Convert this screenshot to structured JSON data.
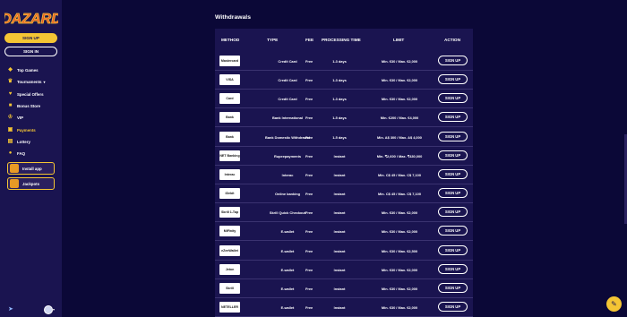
{
  "brand": {
    "name": "DAZARD",
    "accent": "#f4c534",
    "bg": "#0b0837",
    "panel": "#1a1450"
  },
  "auth": {
    "signup_label": "SIGN UP",
    "signin_label": "SIGN IN"
  },
  "nav": [
    {
      "label": "Top Games",
      "icon": "game-controller-icon"
    },
    {
      "label": "Tournaments",
      "icon": "trophy-icon",
      "has_caret": true
    },
    {
      "label": "Special Offers",
      "icon": "gift-icon"
    },
    {
      "label": "Bonus Store",
      "icon": "store-icon"
    },
    {
      "label": "VIP",
      "icon": "crown-icon"
    },
    {
      "label": "Payments",
      "icon": "wallet-icon",
      "active": true
    },
    {
      "label": "Lottery",
      "icon": "ticket-icon"
    },
    {
      "label": "FAQ",
      "icon": "chat-icon"
    }
  ],
  "promos": [
    {
      "label": "Install app",
      "icon": "download-icon"
    },
    {
      "label": "Jackpots",
      "icon": "jackpot-icon"
    }
  ],
  "page": {
    "title": "Withdrawals"
  },
  "table": {
    "headers": {
      "method": "METHOD",
      "type": "TYPE",
      "fee": "FEE",
      "processing": "PROCESSING TIME",
      "limit": "LIMIT",
      "action": "ACTION"
    },
    "rows": [
      {
        "logo": "Mastercard",
        "type": "Credit Card",
        "fee": "Free",
        "time": "1-3 days",
        "limit": "Min. €30 / Max. €2,000",
        "action": "SIGN UP"
      },
      {
        "logo": "VISA",
        "type": "Credit Card",
        "fee": "Free",
        "time": "1-3 days",
        "limit": "Min. €30 / Max. €2,000",
        "action": "SIGN UP"
      },
      {
        "logo": "Card",
        "type": "Credit Card",
        "fee": "Free",
        "time": "1-3 days",
        "limit": "Min. €30 / Max. €2,000",
        "action": "SIGN UP"
      },
      {
        "logo": "Bank",
        "type": "Bank International",
        "fee": "Free",
        "time": "1-5 days",
        "limit": "Min. €200 / Max. €4,000",
        "action": "SIGN UP"
      },
      {
        "logo": "Bank",
        "type": "Bank Domestic Withdrawal",
        "fee": "Free",
        "time": "1-5 days",
        "limit": "Min. A$ 300 / Max. A$ 4,000",
        "action": "SIGN UP"
      },
      {
        "logo": "NET Banking",
        "type": "Rupeepayments",
        "fee": "Free",
        "time": "Instant",
        "limit": "Min. ₹2,600 / Max. ₹430,000",
        "action": "SIGN UP"
      },
      {
        "logo": "Interac",
        "type": "Interac",
        "fee": "Free",
        "time": "Instant",
        "limit": "Min. C$ 45 / Max. C$ 7,100",
        "action": "SIGN UP"
      },
      {
        "logo": "iDebit",
        "type": "Online banking",
        "fee": "Free",
        "time": "Instant",
        "limit": "Min. C$ 45 / Max. C$ 7,100",
        "action": "SIGN UP"
      },
      {
        "logo": "Skrill 1-Tap",
        "type": "Skrill Quick Checkout",
        "fee": "Free",
        "time": "Instant",
        "limit": "Min. €30 / Max. €2,000",
        "action": "SIGN UP"
      },
      {
        "logo": "MiFinity",
        "type": "E-wallet",
        "fee": "Free",
        "time": "Instant",
        "limit": "Min. €30 / Max. €2,000",
        "action": "SIGN UP"
      },
      {
        "logo": "eZeeWallet",
        "type": "E-wallet",
        "fee": "Free",
        "time": "Instant",
        "limit": "Min. €30 / Max. €2,500",
        "action": "SIGN UP"
      },
      {
        "logo": "Jeton",
        "type": "E-wallet",
        "fee": "Free",
        "time": "Instant",
        "limit": "Min. €30 / Max. €2,000",
        "action": "SIGN UP"
      },
      {
        "logo": "Skrill",
        "type": "E-wallet",
        "fee": "Free",
        "time": "Instant",
        "limit": "Min. €30 / Max. €2,000",
        "action": "SIGN UP"
      },
      {
        "logo": "NETELLER",
        "type": "E-wallet",
        "fee": "Free",
        "time": "Instant",
        "limit": "Min. €30 / Max. €2,000",
        "action": "SIGN UP"
      }
    ]
  }
}
